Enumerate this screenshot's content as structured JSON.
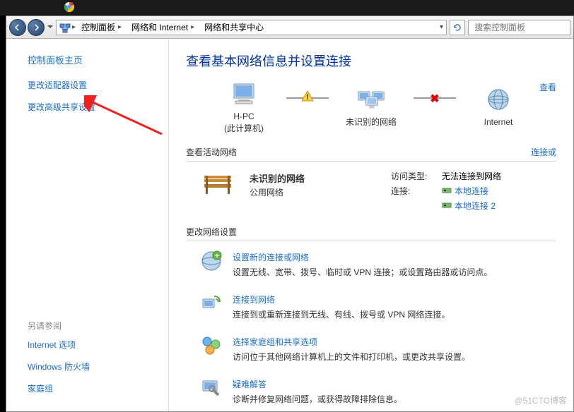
{
  "breadcrumbs": {
    "item1": "控制面板",
    "item2": "网络和 Internet",
    "item3": "网络和共享中心"
  },
  "search": {
    "placeholder": "搜索控制面板"
  },
  "sidebar": {
    "title": "控制面板主页",
    "links": {
      "adapter": "更改适配器设置",
      "sharing": "更改高级共享设置"
    },
    "seeAlso": {
      "title": "另请参阅",
      "internet": "Internet 选项",
      "firewall": "Windows 防火墙",
      "homegroup": "家庭组"
    }
  },
  "main": {
    "title": "查看基本网络信息并设置连接",
    "viewMap": "查看",
    "nodes": {
      "pc": "H-PC",
      "pcSub": "(此计算机)",
      "unknown": "未识别的网络",
      "internet": "Internet"
    },
    "activeNetworks": {
      "heading": "查看活动网络",
      "connectOrDisconnect": "连接或",
      "netName": "未识别的网络",
      "netType": "公用网络",
      "accessTypeLabel": "访问类型:",
      "accessTypeValue": "无法连接到网络",
      "connLabel": "连接:",
      "conn1": "本地连接",
      "conn2": "本地连接 2"
    },
    "changeSettings": {
      "heading": "更改网络设置",
      "item1": {
        "title": "设置新的连接或网络",
        "desc": "设置无线、宽带、拨号、临时或 VPN 连接；或设置路由器或访问点。"
      },
      "item2": {
        "title": "连接到网络",
        "desc": "连接到或重新连接到无线、有线、拨号或 VPN 网络连接。"
      },
      "item3": {
        "title": "选择家庭组和共享选项",
        "desc": "访问位于其他网络计算机上的文件和打印机，或更改共享设置。"
      },
      "item4": {
        "title": "疑难解答",
        "desc": "诊断并修复网络问题，或获得故障排除信息。"
      }
    }
  },
  "watermark": "@51CTO博客"
}
